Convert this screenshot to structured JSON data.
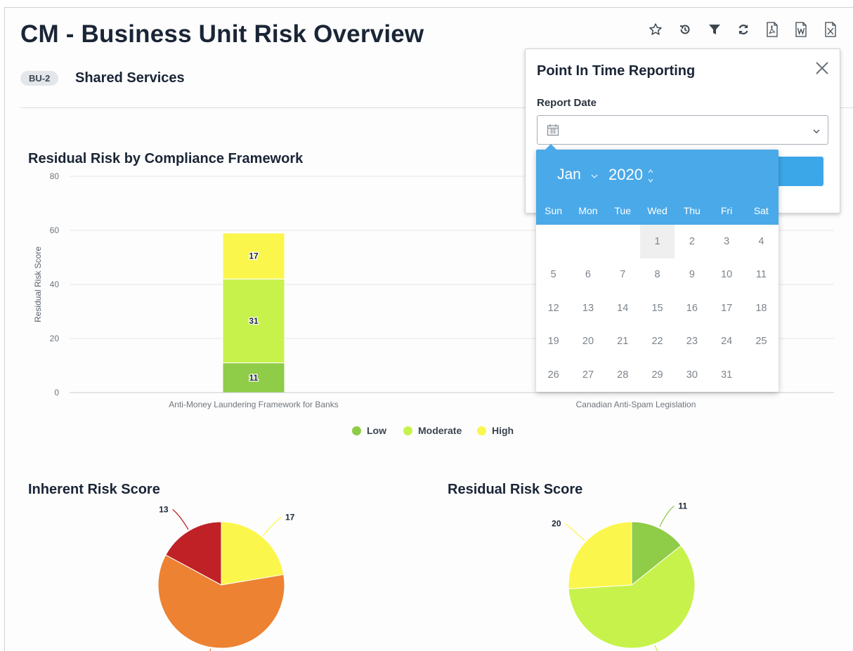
{
  "page": {
    "title": "CM - Business Unit Risk Overview",
    "badge": "BU-2",
    "unit_name": "Shared Services"
  },
  "toolbar": {
    "icons": [
      "star-icon",
      "history-icon",
      "filter-icon",
      "refresh-icon",
      "pdf-export-icon",
      "word-export-icon",
      "excel-export-icon"
    ]
  },
  "bar_section": {
    "title": "Residual Risk by Compliance Framework"
  },
  "inherent_section": {
    "title": "Inherent Risk Score"
  },
  "residual_section": {
    "title": "Residual Risk Score"
  },
  "popup": {
    "title": "Point In Time Reporting",
    "report_date_label": "Report Date",
    "date_value": "",
    "calendar": {
      "month": "Jan",
      "year": "2020",
      "weekdays": [
        "Sun",
        "Mon",
        "Tue",
        "Wed",
        "Thu",
        "Fri",
        "Sat"
      ],
      "start_offset": 3,
      "days": [
        "1",
        "2",
        "3",
        "4",
        "5",
        "6",
        "7",
        "8",
        "9",
        "10",
        "11",
        "12",
        "13",
        "14",
        "15",
        "16",
        "17",
        "18",
        "19",
        "20",
        "21",
        "22",
        "23",
        "24",
        "25",
        "26",
        "27",
        "28",
        "29",
        "30",
        "31"
      ],
      "selected": "1",
      "header_color": "#4aa9e9"
    }
  },
  "chart_data": [
    {
      "type": "bar",
      "stacked": true,
      "title": "Residual Risk by Compliance Framework",
      "ylabel": "Residual Risk Score",
      "ylim": [
        0,
        80
      ],
      "yticks": [
        "0",
        "20",
        "40",
        "60",
        "80"
      ],
      "categories": [
        "Anti-Money Laundering Framework for Banks",
        "Canadian Anti-Spam Legislation"
      ],
      "series": [
        {
          "name": "Low",
          "color": "#8fcc47",
          "values": [
            11,
            null
          ]
        },
        {
          "name": "Moderate",
          "color": "#c7f24c",
          "values": [
            31,
            null
          ]
        },
        {
          "name": "High",
          "color": "#fbf64c",
          "values": [
            17,
            null
          ]
        }
      ],
      "data_labels": [
        "11",
        "31",
        "17"
      ],
      "legend_position": "bottom",
      "grid": true
    },
    {
      "type": "pie",
      "title": "Inherent Risk Score",
      "slices": [
        {
          "value": 17,
          "color": "#fbf64c",
          "label": "17"
        },
        {
          "value": 46,
          "color": "#ec8232",
          "label": ""
        },
        {
          "value": 13,
          "color": "#bf2127",
          "label": "13"
        }
      ]
    },
    {
      "type": "pie",
      "title": "Residual Risk Score",
      "slices": [
        {
          "value": 11,
          "color": "#8fcc47",
          "label": "11"
        },
        {
          "value": 46,
          "color": "#c7f24c",
          "label": ""
        },
        {
          "value": 20,
          "color": "#fbf64c",
          "label": "20"
        }
      ]
    }
  ]
}
